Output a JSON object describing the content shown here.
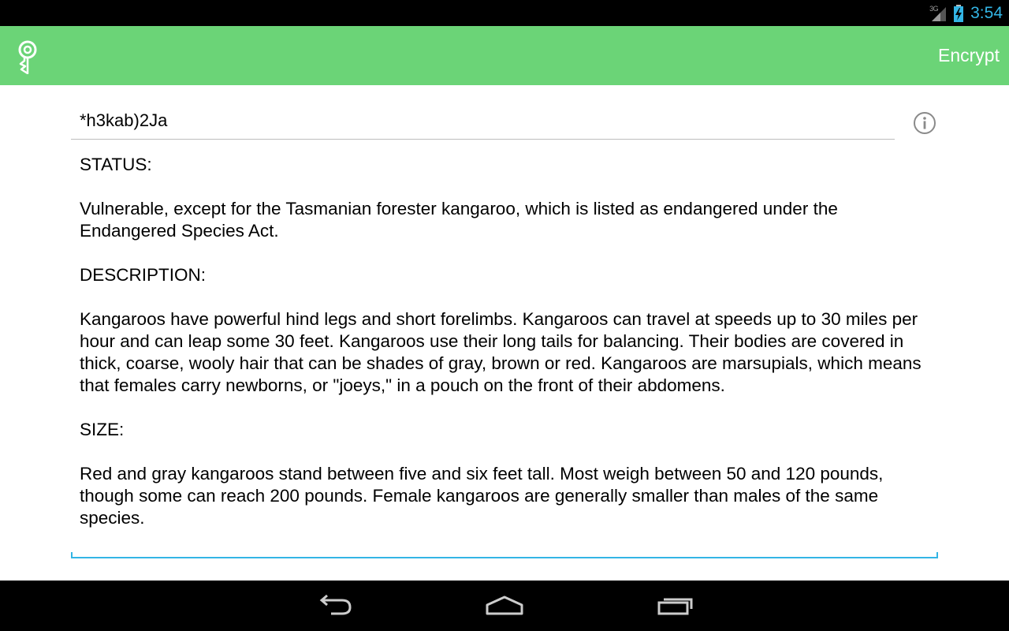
{
  "status_bar": {
    "network": "3G",
    "time": "3:54"
  },
  "action_bar": {
    "encrypt_label": "Encrypt"
  },
  "key_field": {
    "value": "*h3kab)2Ja"
  },
  "message": {
    "text": "STATUS:\n\nVulnerable, except for the Tasmanian forester kangaroo, which is listed as endangered under the Endangered Species Act.\n\nDESCRIPTION:\n\nKangaroos have powerful hind legs and short forelimbs. Kangaroos can travel at speeds up to 30 miles per hour and can leap some 30 feet. Kangaroos use their long tails for balancing. Their bodies are covered in thick, coarse, wooly hair that can be shades of gray, brown or red. Kangaroos are marsupials, which means that females carry newborns, or \"joeys,\" in a pouch on the front of their abdomens.\n\nSIZE:\n\nRed and gray kangaroos stand between five and six feet tall. Most weigh between 50 and 120 pounds, though some can reach 200 pounds. Female kangaroos are generally smaller than males of the same species."
  },
  "colors": {
    "action_bar": "#6bd477",
    "accent": "#33b5e5",
    "system_bars": "#000000"
  },
  "icons": {
    "app": "key-icon",
    "info": "info-icon",
    "back": "back-icon",
    "home": "home-icon",
    "recents": "recents-icon"
  }
}
